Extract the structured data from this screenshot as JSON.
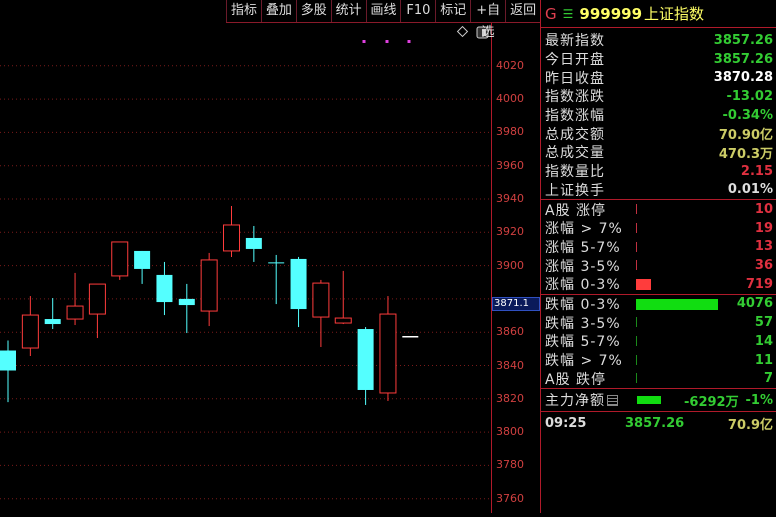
{
  "toolbar": [
    "指标",
    "叠加",
    "多股",
    "统计",
    "画线",
    "F10",
    "标记",
    "+自选",
    "返回"
  ],
  "y_axis": {
    "ticks": [
      4020,
      4000,
      3980,
      3960,
      3940,
      3920,
      3900,
      3860,
      3840,
      3820,
      3800,
      3780,
      3760
    ],
    "range": [
      3753,
      4040
    ],
    "current_label": "3871.1"
  },
  "colors": {
    "up": "#ff3c3c",
    "down": "#54ffff",
    "grid": "#7a1a1a",
    "green": "#33cc33",
    "yellow": "#cccc66"
  },
  "chart_data": {
    "type": "candlestick",
    "candles": [
      {
        "o": 3849,
        "h": 3855,
        "l": 3818,
        "c": 3837
      },
      {
        "o": 3850.5,
        "h": 3881.7,
        "l": 3845.7,
        "c": 3870.3
      },
      {
        "o": 3867.9,
        "h": 3880.5,
        "l": 3861.9,
        "c": 3864.9
      },
      {
        "o": 3867.9,
        "h": 3895.6,
        "l": 3864.3,
        "c": 3875.7
      },
      {
        "o": 3870.9,
        "h": 3888.9,
        "l": 3856.5,
        "c": 3888.9
      },
      {
        "o": 3893.8,
        "h": 3914.2,
        "l": 3891.4,
        "c": 3914.2
      },
      {
        "o": 3908.8,
        "h": 3908.8,
        "l": 3889,
        "c": 3898
      },
      {
        "o": 3894.4,
        "h": 3902.2,
        "l": 3870.3,
        "c": 3878.1
      },
      {
        "o": 3880,
        "h": 3889,
        "l": 3859.5,
        "c": 3876.3
      },
      {
        "o": 3872.7,
        "h": 3907.6,
        "l": 3863.7,
        "c": 3903.4
      },
      {
        "o": 3908.8,
        "h": 3935.8,
        "l": 3905.2,
        "c": 3924.4
      },
      {
        "o": 3916.6,
        "h": 3923.8,
        "l": 3902.2,
        "c": 3910
      },
      {
        "o": 3901.6,
        "h": 3906.4,
        "l": 3876.9,
        "c": 3901.6
      },
      {
        "o": 3904,
        "h": 3905.2,
        "l": 3863.1,
        "c": 3873.9
      },
      {
        "o": 3869.1,
        "h": 3891.4,
        "l": 3851.1,
        "c": 3889.5
      },
      {
        "o": 3865.5,
        "h": 3896.8,
        "l": 3864.9,
        "c": 3868.5
      },
      {
        "o": 3861.9,
        "h": 3863.1,
        "l": 3816.3,
        "c": 3825.3
      },
      {
        "o": 3823.5,
        "h": 3881.7,
        "l": 3818.7,
        "c": 3870.9
      },
      {
        "o": 3857.26,
        "h": 3857.26,
        "l": 3857.26,
        "c": 3857.26
      }
    ]
  },
  "panel": {
    "g": "G",
    "menu": "☰",
    "code": "999999",
    "name": "上证指数",
    "stats": [
      {
        "label": "最新指数",
        "value": "3857.26",
        "color": "#33cc33"
      },
      {
        "label": "今日开盘",
        "value": "3857.26",
        "color": "#33cc33"
      },
      {
        "label": "昨日收盘",
        "value": "3870.28",
        "color": "#ffffff"
      },
      {
        "label": "指数涨跌",
        "value": "-13.02",
        "color": "#33cc33"
      },
      {
        "label": "指数涨幅",
        "value": "-0.34%",
        "color": "#33cc33"
      },
      {
        "label": "总成交额",
        "value": "70.90亿",
        "color": "#cccc66"
      },
      {
        "label": "总成交量",
        "value": "470.3万",
        "color": "#cccc66"
      },
      {
        "label": "指数量比",
        "value": "2.15",
        "color": "#e03040"
      },
      {
        "label": "上证换手",
        "value": "0.01%",
        "color": "#dddddd"
      }
    ],
    "up": [
      {
        "label": "A股 涨停",
        "value": "10",
        "bar": 0
      },
      {
        "label": "涨幅 > 7%",
        "value": "19",
        "bar": 0
      },
      {
        "label": "涨幅 5-7%",
        "value": "13",
        "bar": 0
      },
      {
        "label": "涨幅 3-5%",
        "value": "36",
        "bar": 0
      },
      {
        "label": "涨幅 0-3%",
        "value": "719",
        "bar": 0.18
      }
    ],
    "down": [
      {
        "label": "跌幅 0-3%",
        "value": "4076",
        "bar": 1
      },
      {
        "label": "跌幅 3-5%",
        "value": "57",
        "bar": 0
      },
      {
        "label": "跌幅 5-7%",
        "value": "14",
        "bar": 0
      },
      {
        "label": "跌幅 > 7%",
        "value": "11",
        "bar": 0
      },
      {
        "label": "A股 跌停",
        "value": "7",
        "bar": 0
      }
    ],
    "flow": {
      "label": "主力净额",
      "value": "-6292万",
      "pct": "-1%"
    },
    "foot": {
      "time": "09:25",
      "price": "3857.26",
      "amount": "70.9亿"
    }
  }
}
